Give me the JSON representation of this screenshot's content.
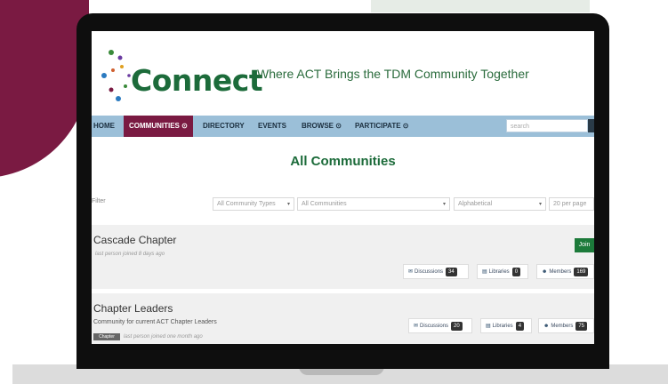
{
  "logo": {
    "text": "Connect"
  },
  "header": {
    "tagline": "Where ACT Brings the TDM Community Together"
  },
  "nav": {
    "items": [
      "HOME",
      "COMMUNITIES",
      "DIRECTORY",
      "EVENTS",
      "BROWSE",
      "PARTICIPATE"
    ],
    "search_placeholder": "search"
  },
  "page": {
    "title": "All Communities"
  },
  "filters": {
    "label": "Filter",
    "type_value": "All Community Types",
    "community_value": "All Communities",
    "sort_value": "Alphabetical",
    "per_page_value": "20 per page"
  },
  "communities": [
    {
      "title": "Cascade Chapter",
      "meta": "last person joined 8 days ago",
      "join_label": "Join",
      "discussions_label": "Discussions",
      "discussions_count": "34",
      "libraries_label": "Libraries",
      "libraries_count": "0",
      "members_label": "Members",
      "members_count": "169"
    },
    {
      "title": "Chapter Leaders",
      "description": "Community for current ACT Chapter Leaders",
      "badge": "Chapter",
      "meta": "last person joined one month ago",
      "discussions_label": "Discussions",
      "discussions_count": "20",
      "libraries_label": "Libraries",
      "libraries_count": "4",
      "members_label": "Members",
      "members_count": "75"
    }
  ],
  "colors": {
    "maroon": "#7a1a42",
    "green": "#1c6b3a",
    "nav_blue": "#9bbfd8"
  },
  "icons": {
    "discussions": "speech-bubbles-icon",
    "libraries": "files-icon",
    "members": "people-icon"
  }
}
